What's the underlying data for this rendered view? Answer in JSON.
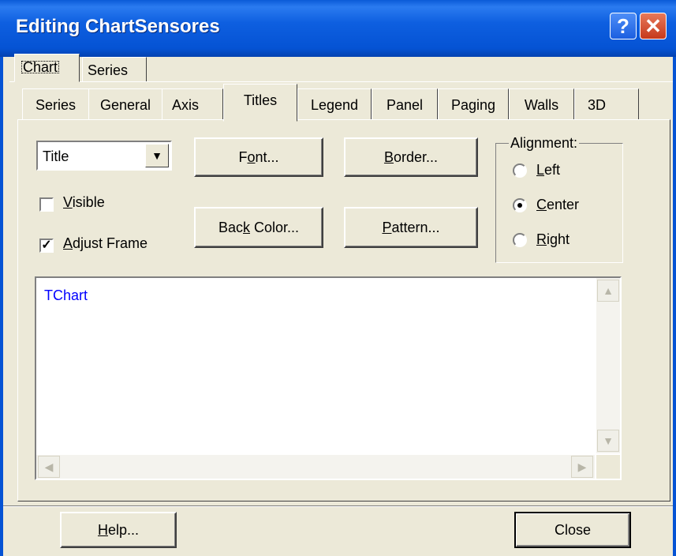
{
  "window": {
    "title": "Editing ChartSensores",
    "help_glyph": "?",
    "close_glyph": "✕"
  },
  "top_tabs": [
    {
      "label": "Chart",
      "selected": true
    },
    {
      "label": "Series",
      "selected": false
    }
  ],
  "inner_tabs": [
    {
      "label": "Series",
      "selected": false
    },
    {
      "label": "General",
      "selected": false
    },
    {
      "label": "Axis",
      "selected": false
    },
    {
      "label": "Titles",
      "selected": true
    },
    {
      "label": "Legend",
      "selected": false
    },
    {
      "label": "Panel",
      "selected": false
    },
    {
      "label": "Paging",
      "selected": false
    },
    {
      "label": "Walls",
      "selected": false
    },
    {
      "label": "3D",
      "selected": false
    }
  ],
  "titles": {
    "title_select": {
      "value": "Title",
      "arrow": "▼"
    },
    "font_button": {
      "pre": "F",
      "ul": "o",
      "post": "nt..."
    },
    "border_button": {
      "pre": "",
      "ul": "B",
      "post": "order..."
    },
    "back_color_button": {
      "pre": "Bac",
      "ul": "k",
      "post": " Color..."
    },
    "pattern_button": {
      "pre": "",
      "ul": "P",
      "post": "attern..."
    },
    "visible": {
      "pre": "",
      "ul": "V",
      "post": "isible",
      "checked": false
    },
    "adjust_frame": {
      "pre": "",
      "ul": "A",
      "post": "djust Frame",
      "checked": true,
      "mark": "✓"
    },
    "alignment": {
      "title": "Alignment:",
      "options": [
        {
          "pre": "",
          "ul": "L",
          "post": "eft",
          "selected": false
        },
        {
          "pre": "",
          "ul": "C",
          "post": "enter",
          "selected": true
        },
        {
          "pre": "",
          "ul": "R",
          "post": "ight",
          "selected": false
        }
      ]
    },
    "text": "TChart"
  },
  "scroll_glyphs": {
    "up": "▲",
    "down": "▼",
    "left": "◀",
    "right": "▶"
  },
  "footer": {
    "help_button": {
      "pre": "",
      "ul": "H",
      "post": "elp..."
    },
    "close_button": "Close"
  },
  "colors": {
    "titlebar": "#0553d4",
    "face": "#ece9d8",
    "title_text": "#0000ff"
  }
}
